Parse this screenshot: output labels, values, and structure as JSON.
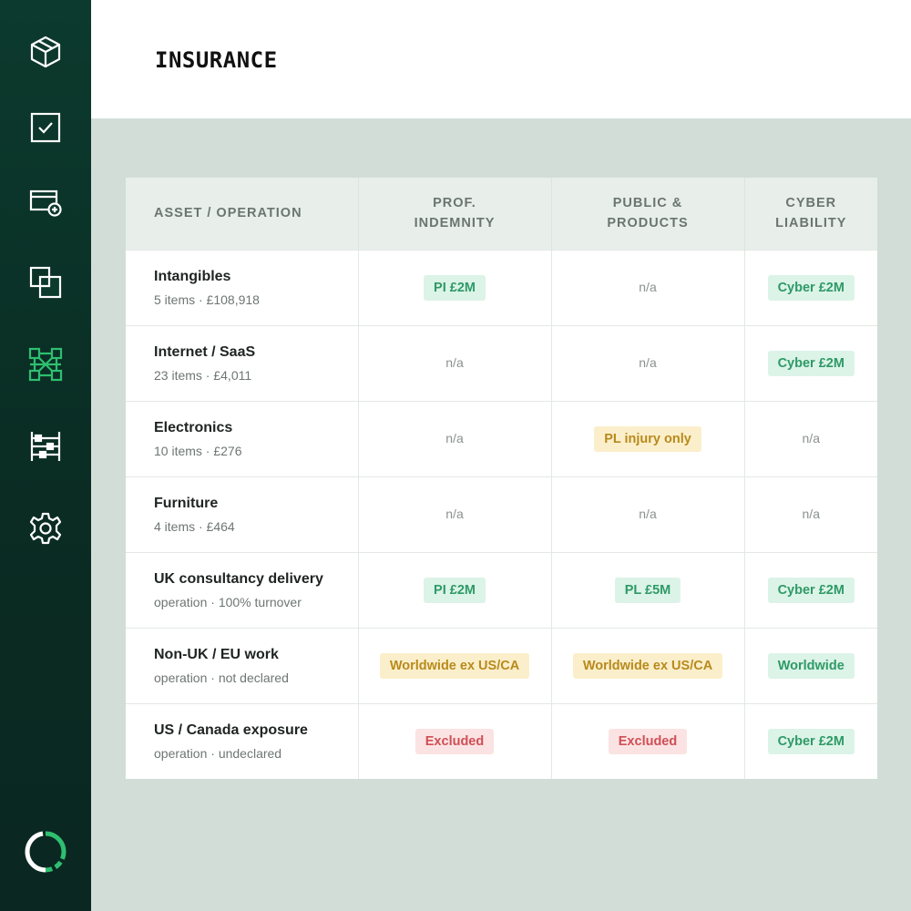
{
  "sidebar": {
    "items": [
      {
        "icon": "box-icon",
        "active": false
      },
      {
        "icon": "checkbox-icon",
        "active": false
      },
      {
        "icon": "card-add-icon",
        "active": false
      },
      {
        "icon": "copy-icon",
        "active": false
      },
      {
        "icon": "network-grid-icon",
        "active": true
      },
      {
        "icon": "abacus-icon",
        "active": false
      },
      {
        "icon": "gear-icon",
        "active": false
      }
    ],
    "logo": "loading-ring-logo"
  },
  "header": {
    "title": "INSURANCE"
  },
  "table": {
    "columns": [
      "ASSET / OPERATION",
      "PROF. INDEMNITY",
      "PUBLIC & PRODUCTS",
      "CYBER LIABILITY"
    ],
    "column_lines": [
      [
        "ASSET / OPERATION"
      ],
      [
        "PROF.",
        "INDEMNITY"
      ],
      [
        "PUBLIC &",
        "PRODUCTS"
      ],
      [
        "CYBER",
        "LIABILITY"
      ]
    ],
    "rows": [
      {
        "name": "Intangibles",
        "sub": "5 items · £108,918",
        "cells": [
          {
            "text": "PI £2M",
            "style": "green"
          },
          {
            "text": "n/a",
            "style": "na"
          },
          {
            "text": "Cyber £2M",
            "style": "green"
          }
        ]
      },
      {
        "name": "Internet / SaaS",
        "sub": "23 items · £4,011",
        "cells": [
          {
            "text": "n/a",
            "style": "na"
          },
          {
            "text": "n/a",
            "style": "na"
          },
          {
            "text": "Cyber £2M",
            "style": "green"
          }
        ]
      },
      {
        "name": "Electronics",
        "sub": "10 items · £276",
        "cells": [
          {
            "text": "n/a",
            "style": "na"
          },
          {
            "text": "PL injury only",
            "style": "yellow"
          },
          {
            "text": "n/a",
            "style": "na"
          }
        ]
      },
      {
        "name": "Furniture",
        "sub": "4 items · £464",
        "cells": [
          {
            "text": "n/a",
            "style": "na"
          },
          {
            "text": "n/a",
            "style": "na"
          },
          {
            "text": "n/a",
            "style": "na"
          }
        ]
      },
      {
        "name": "UK consultancy delivery",
        "sub": "operation · 100% turnover",
        "cells": [
          {
            "text": "PI £2M",
            "style": "green"
          },
          {
            "text": "PL £5M",
            "style": "green"
          },
          {
            "text": "Cyber £2M",
            "style": "green"
          }
        ]
      },
      {
        "name": "Non-UK / EU work",
        "sub": "operation · not declared",
        "cells": [
          {
            "text": "Worldwide ex US/CA",
            "style": "yellow"
          },
          {
            "text": "Worldwide ex US/CA",
            "style": "yellow"
          },
          {
            "text": "Worldwide",
            "style": "green"
          }
        ]
      },
      {
        "name": "US / Canada exposure",
        "sub": "operation · undeclared",
        "cells": [
          {
            "text": "Excluded",
            "style": "red"
          },
          {
            "text": "Excluded",
            "style": "red"
          },
          {
            "text": "Cyber £2M",
            "style": "green"
          }
        ]
      }
    ]
  },
  "colors": {
    "sidebar_bg": "#0c3a2e",
    "active_icon": "#2fbf71",
    "icon": "#ffffff",
    "content_bg": "#d3ddd8",
    "pill_green": "#2e9a66",
    "pill_yellow": "#b88a1c",
    "pill_red": "#cf4f55"
  }
}
